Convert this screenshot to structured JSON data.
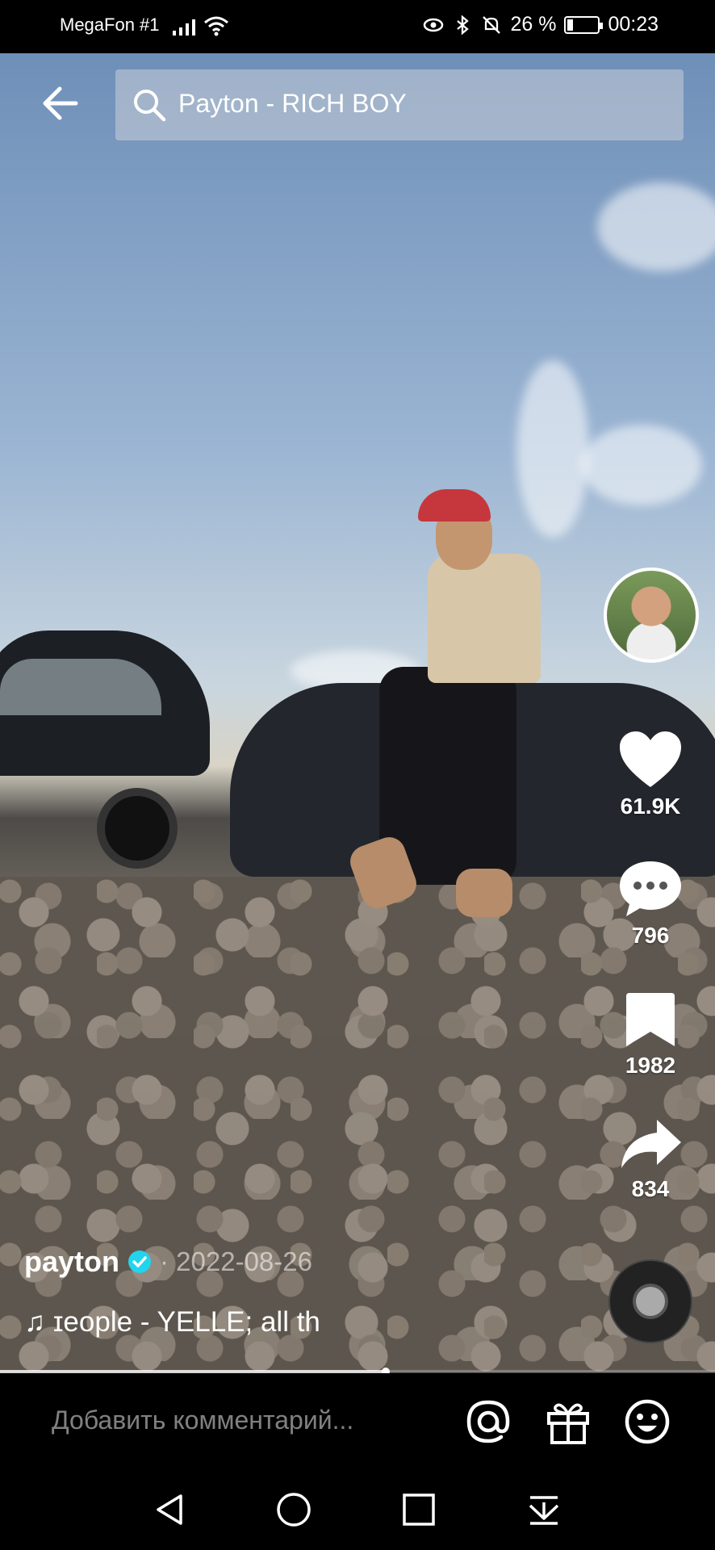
{
  "status_bar": {
    "carrier": "MegaFon #1",
    "battery": "26 %",
    "battery_level": 0.26,
    "time": "00:23",
    "icons": [
      "signal-icon",
      "wifi-icon",
      "eye-icon",
      "bluetooth-icon",
      "mute-icon",
      "battery-icon"
    ]
  },
  "search": {
    "query": "Payton - RICH BOY",
    "back_icon": "back-arrow-icon",
    "search_icon": "search-icon"
  },
  "actions": {
    "likes": "61.9K",
    "comments": "796",
    "saves": "1982",
    "shares": "834"
  },
  "video": {
    "author": "payton",
    "date": "· 2022-08-26",
    "music": "♫ ɪeople - YELLE;    all th",
    "progress": 0.54
  },
  "comment_bar": {
    "placeholder": "Добавить комментарий...",
    "icons": [
      "mention-icon",
      "gift-icon",
      "emoji-icon"
    ]
  },
  "nav": {
    "icons": [
      "nav-back-icon",
      "nav-home-icon",
      "nav-recents-icon",
      "nav-notifications-icon"
    ]
  },
  "colors": {
    "accent_verified": "#20D5EC",
    "background": "#000000"
  }
}
